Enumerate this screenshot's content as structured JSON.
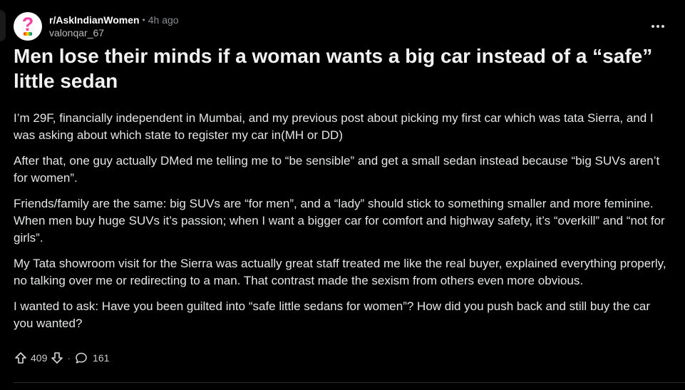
{
  "post": {
    "subreddit": "r/AskIndianWomen",
    "separator": "•",
    "time": "4h ago",
    "author": "valonqar_67",
    "more_icon": "ellipsis-icon",
    "title": "Men lose their minds if a woman wants a big car instead of a “safe” little sedan",
    "paragraphs": [
      "I’m 29F, financially independent in Mumbai, and my previous post about picking my first car which was tata Sierra, and I was asking about which state to register my car in(MH or DD)",
      "After that, one guy actually DMed me telling me to “be sensible” and get a small sedan instead because “big SUVs aren’t for women”.",
      "Friends/family are the same: big SUVs are “for men”, and a “lady” should stick to something smaller and more feminine. When men buy huge SUVs it’s passion; when I want a bigger car for comfort and highway safety, it’s “overkill” and “not for girls”.",
      "My Tata showroom visit for the Sierra was actually great staff treated me like the real buyer, explained everything properly, no talking over me or redirecting to a man. That contrast made the sexism from others even more obvious.",
      "I wanted to ask: Have you been guilted into “safe little sedans for women”? How did you push back and still buy the car you wanted?"
    ],
    "votes": "409",
    "comments": "161",
    "action_separator": "·"
  },
  "avatar": {
    "glyph": "?",
    "accent": "#ff3fa4",
    "background": "#ffffff"
  },
  "colors": {
    "background": "#000000",
    "title": "#f2f2f2",
    "muted": "#8b8f92"
  }
}
